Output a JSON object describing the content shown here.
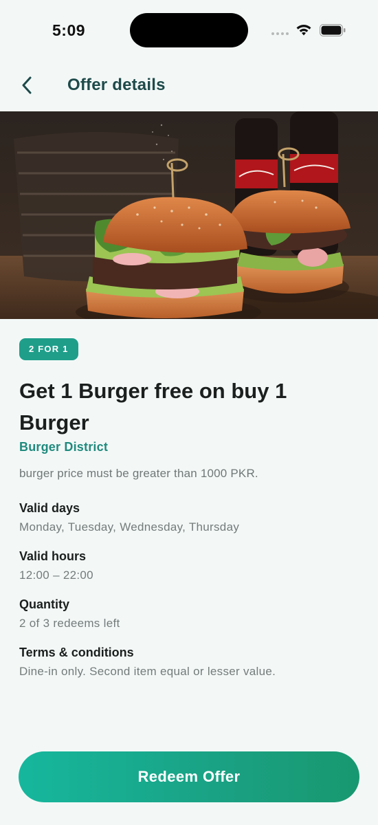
{
  "status_bar": {
    "time": "5:09",
    "icons": [
      "signal-icon",
      "wifi-icon",
      "battery-icon"
    ]
  },
  "header": {
    "back_icon": "chevron-left-icon",
    "title": "Offer details"
  },
  "hero": {
    "image": "burger-photo"
  },
  "offer": {
    "badge": "2 FOR 1",
    "title": "Get 1 Burger free on buy 1 Burger",
    "merchant": "Burger District",
    "condition": "burger price must be greater than 1000 PKR."
  },
  "details": {
    "valid_days": {
      "label": "Valid days",
      "value": "Monday, Tuesday, Wednesday, Thursday"
    },
    "valid_hours": {
      "label": "Valid hours",
      "value": "12:00 – 22:00"
    },
    "quantity": {
      "label": "Quantity",
      "value": "2 of 3 redeems left"
    },
    "terms": {
      "label": "Terms & conditions",
      "value": "Dine-in only. Second item equal or lesser value."
    }
  },
  "cta": {
    "label": "Redeem Offer"
  },
  "colors": {
    "accent": "#1f9e8a",
    "title": "#1e4a4a",
    "merchant": "#1f8a7d",
    "background": "#f3f8f7"
  }
}
